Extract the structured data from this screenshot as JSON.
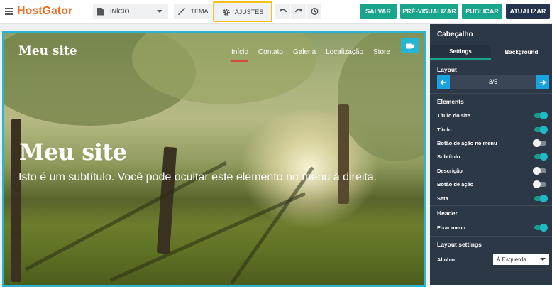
{
  "topbar": {
    "logo": "HostGator",
    "page_select": "INÍCIO",
    "tema_label": "TEMA",
    "ajustes_label": "AJUSTES",
    "salvar_label": "SALVAR",
    "previsualizar_label": "PRÉ-VISUALIZAR",
    "publicar_label": "PUBLICAR",
    "atualizar_label": "ATUALIZAR",
    "accent": "#19a58b",
    "dark": "#24344e",
    "highlight": "#f2c31b"
  },
  "site": {
    "logo": "Meu site",
    "nav": [
      "Início",
      "Contato",
      "Galeria",
      "Localização",
      "Store"
    ],
    "hero_title": "Meu site",
    "hero_subtitle": "Isto é um subtítulo. Você pode ocultar este elemento no menu à direita."
  },
  "panel": {
    "title": "Cabeçalho",
    "tabs": [
      "Settings",
      "Background"
    ],
    "layout_label": "Layout",
    "layout_value": "3/5",
    "elements_label": "Elements",
    "elements": [
      {
        "label": "Título do site",
        "on": true
      },
      {
        "label": "Título",
        "on": true
      },
      {
        "label": "Botão de ação no menu",
        "on": false
      },
      {
        "label": "Subtítulo",
        "on": true
      },
      {
        "label": "Descrição",
        "on": false
      },
      {
        "label": "Botão de ação",
        "on": false
      },
      {
        "label": "Seta",
        "on": true
      }
    ],
    "header_label": "Header",
    "fixar_menu_label": "Fixar menu",
    "fixar_menu_on": true,
    "layout_settings_label": "Layout settings",
    "alinhar_label": "Alinhar",
    "alinhar_value": "À Esquerda"
  }
}
